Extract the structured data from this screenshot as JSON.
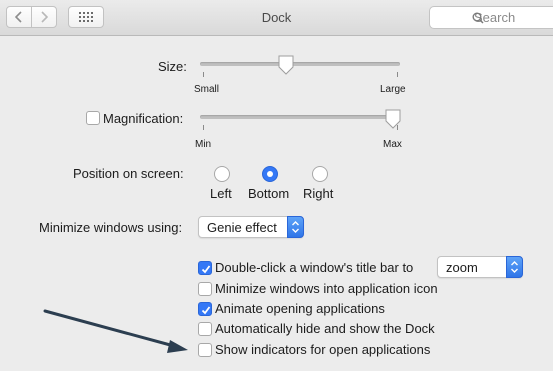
{
  "window": {
    "title": "Dock"
  },
  "search": {
    "placeholder": "Search"
  },
  "size": {
    "label": "Size:",
    "min_label": "Small",
    "max_label": "Large",
    "value": 0.5
  },
  "magnification": {
    "label": "Magnification:",
    "checked": false,
    "min_label": "Min",
    "max_label": "Max",
    "value": 1.0
  },
  "position": {
    "label": "Position on screen:",
    "options": [
      {
        "label": "Left",
        "selected": false
      },
      {
        "label": "Bottom",
        "selected": true
      },
      {
        "label": "Right",
        "selected": false
      }
    ]
  },
  "minimize": {
    "label": "Minimize windows using:",
    "value": "Genie effect"
  },
  "options": [
    {
      "label": "Double-click a window's title bar to",
      "checked": true
    },
    {
      "label": "Minimize windows into application icon",
      "checked": false
    },
    {
      "label": "Animate opening applications",
      "checked": true
    },
    {
      "label": "Automatically hide and show the Dock",
      "checked": false
    },
    {
      "label": "Show indicators for open applications",
      "checked": false
    }
  ],
  "double_click_action": {
    "value": "zoom"
  },
  "colors": {
    "accent": "#3478f6",
    "annotation_arrow": "#2c3e50"
  }
}
